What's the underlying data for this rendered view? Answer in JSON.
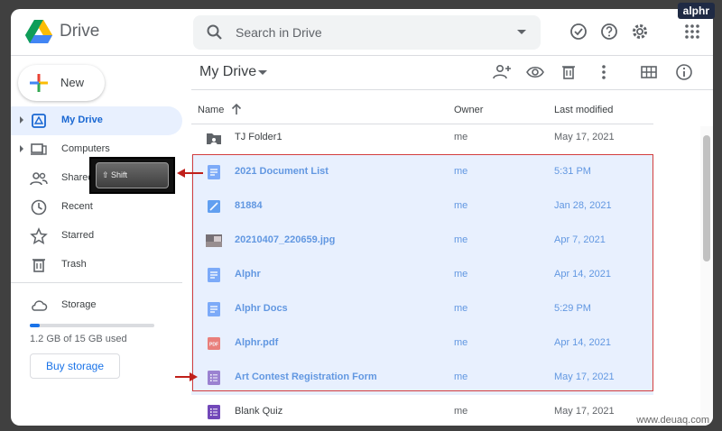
{
  "app": {
    "title": "Drive",
    "watermark": "alphr",
    "credit": "www.deuaq.com"
  },
  "search": {
    "placeholder": "Search in Drive"
  },
  "sidebar": {
    "new_label": "New",
    "items": [
      {
        "label": "My Drive",
        "icon": "my-drive-icon",
        "active": true
      },
      {
        "label": "Computers",
        "icon": "computers-icon"
      },
      {
        "label": "Shared with me",
        "icon": "shared-icon"
      },
      {
        "label": "Recent",
        "icon": "recent-icon"
      },
      {
        "label": "Starred",
        "icon": "star-icon"
      },
      {
        "label": "Trash",
        "icon": "trash-icon"
      }
    ],
    "storage": {
      "label": "Storage",
      "used_text": "1.2 GB of 15 GB used",
      "used_fraction": 0.08,
      "buy_label": "Buy storage"
    }
  },
  "shift_key": {
    "label": "⇧ Shift"
  },
  "main": {
    "title": "My Drive",
    "columns": {
      "name": "Name",
      "owner": "Owner",
      "modified": "Last modified"
    },
    "files": [
      {
        "name": "TJ Folder1",
        "type": "folder",
        "owner": "me",
        "modified": "May 17, 2021",
        "selected": false
      },
      {
        "name": "2021 Document List",
        "type": "doc",
        "owner": "me",
        "modified": "5:31 PM",
        "selected": true
      },
      {
        "name": "81884",
        "type": "image-file",
        "owner": "me",
        "modified": "Jan 28, 2021",
        "selected": true
      },
      {
        "name": "20210407_220659.jpg",
        "type": "photo",
        "owner": "me",
        "modified": "Apr 7, 2021",
        "selected": true
      },
      {
        "name": "Alphr",
        "type": "doc",
        "owner": "me",
        "modified": "Apr 14, 2021",
        "selected": true
      },
      {
        "name": "Alphr Docs",
        "type": "doc",
        "owner": "me",
        "modified": "5:29 PM",
        "selected": true
      },
      {
        "name": "Alphr.pdf",
        "type": "pdf",
        "owner": "me",
        "modified": "Apr 14, 2021",
        "selected": true
      },
      {
        "name": "Art Contest Registration Form",
        "type": "form",
        "owner": "me",
        "modified": "May 17, 2021",
        "selected": true
      },
      {
        "name": "Blank Quiz",
        "type": "form",
        "owner": "me",
        "modified": "May 17, 2021",
        "selected": false
      }
    ]
  },
  "colors": {
    "accent": "#1a73e8",
    "selection": "#e8f0fe",
    "annotation": "#c0201a"
  }
}
